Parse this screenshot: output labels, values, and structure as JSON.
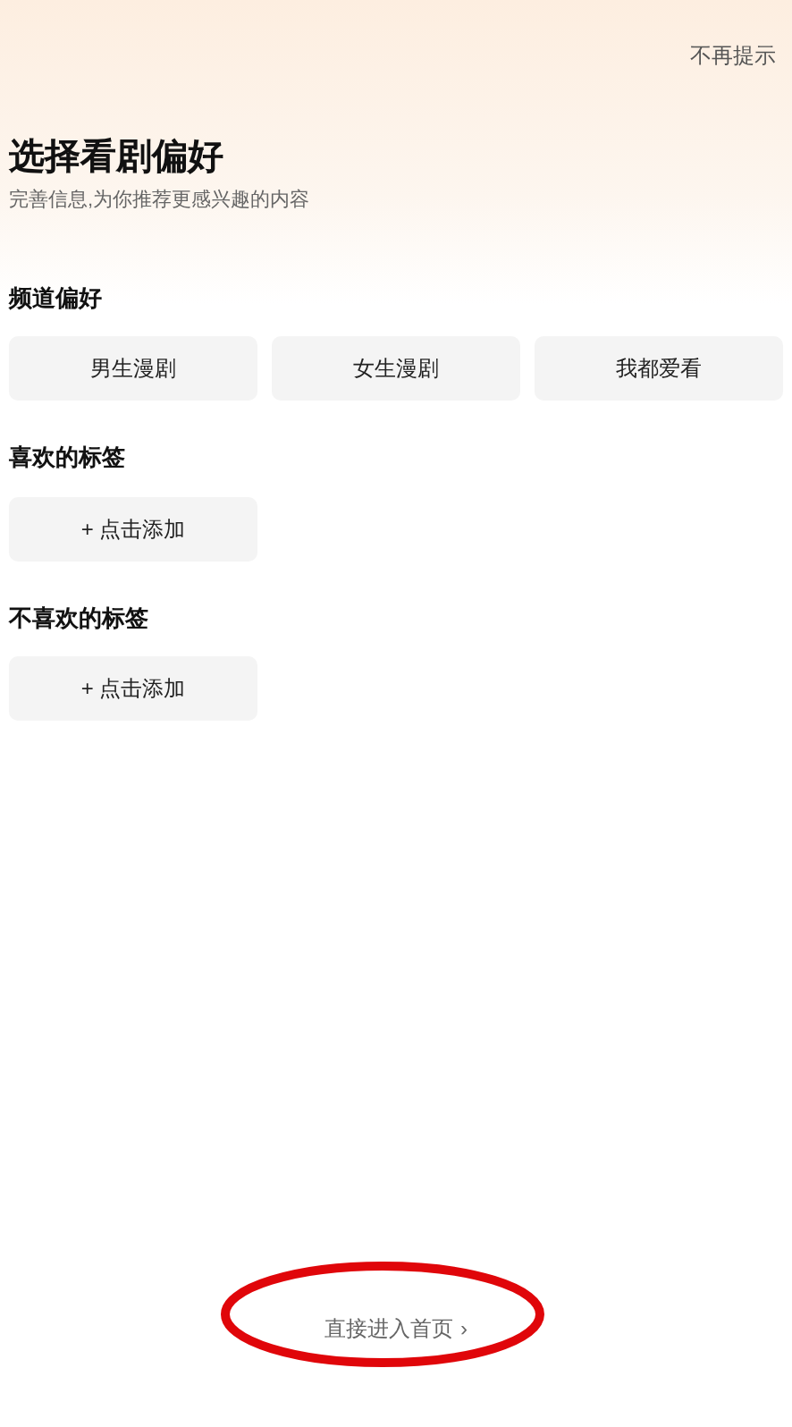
{
  "skip_link": "不再提示",
  "title": "选择看剧偏好",
  "subtitle": "完善信息,为你推荐更感兴趣的内容",
  "sections": [
    {
      "heading": "频道偏好",
      "options": [
        "男生漫剧",
        "女生漫剧",
        "我都爱看"
      ]
    },
    {
      "heading": "喜欢的标签",
      "options": [
        "+ 点击添加"
      ]
    },
    {
      "heading": "不喜欢的标签",
      "options": [
        "+ 点击添加"
      ]
    }
  ],
  "enter_home": {
    "label": "直接进入首页",
    "arrow": "›"
  }
}
